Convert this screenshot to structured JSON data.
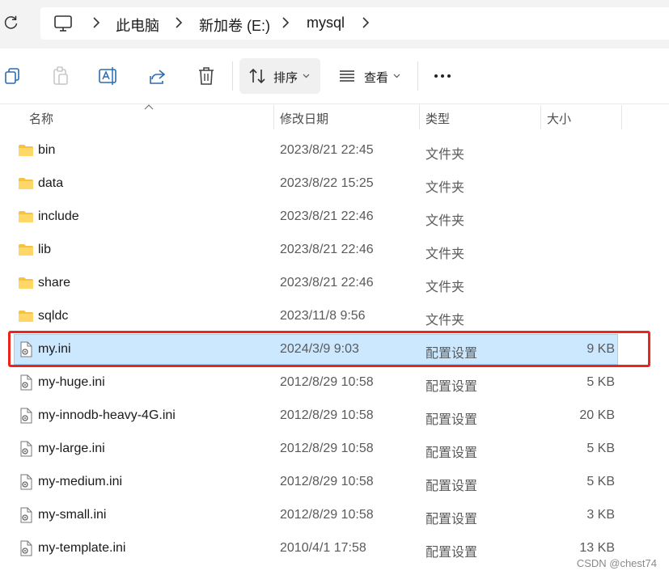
{
  "address_bar": {
    "breadcrumbs": [
      "此电脑",
      "新加卷 (E:)",
      "mysql"
    ],
    "root_icon": "monitor-icon"
  },
  "toolbar": {
    "icons": [
      "copy-icon",
      "paste-icon",
      "rename-icon",
      "share-icon",
      "delete-icon",
      "more-icon"
    ],
    "sort_label": "排序",
    "view_label": "查看",
    "more_label": "..."
  },
  "columns": {
    "name": "名称",
    "date": "修改日期",
    "type": "类型",
    "size": "大小"
  },
  "files": [
    {
      "name": "bin",
      "date": "2023/8/21 22:45",
      "type": "文件夹",
      "size": "",
      "icon": "folder-icon"
    },
    {
      "name": "data",
      "date": "2023/8/22 15:25",
      "type": "文件夹",
      "size": "",
      "icon": "folder-icon"
    },
    {
      "name": "include",
      "date": "2023/8/21 22:46",
      "type": "文件夹",
      "size": "",
      "icon": "folder-icon"
    },
    {
      "name": "lib",
      "date": "2023/8/21 22:46",
      "type": "文件夹",
      "size": "",
      "icon": "folder-icon"
    },
    {
      "name": "share",
      "date": "2023/8/21 22:46",
      "type": "文件夹",
      "size": "",
      "icon": "folder-icon"
    },
    {
      "name": "sqldc",
      "date": "2023/11/8 9:56",
      "type": "文件夹",
      "size": "",
      "icon": "folder-icon"
    },
    {
      "name": "my.ini",
      "date": "2024/3/9 9:03",
      "type": "配置设置",
      "size": "9 KB",
      "icon": "settings-file-icon",
      "selected": true
    },
    {
      "name": "my-huge.ini",
      "date": "2012/8/29 10:58",
      "type": "配置设置",
      "size": "5 KB",
      "icon": "settings-file-icon"
    },
    {
      "name": "my-innodb-heavy-4G.ini",
      "date": "2012/8/29 10:58",
      "type": "配置设置",
      "size": "20 KB",
      "icon": "settings-file-icon"
    },
    {
      "name": "my-large.ini",
      "date": "2012/8/29 10:58",
      "type": "配置设置",
      "size": "5 KB",
      "icon": "settings-file-icon"
    },
    {
      "name": "my-medium.ini",
      "date": "2012/8/29 10:58",
      "type": "配置设置",
      "size": "5 KB",
      "icon": "settings-file-icon"
    },
    {
      "name": "my-small.ini",
      "date": "2012/8/29 10:58",
      "type": "配置设置",
      "size": "3 KB",
      "icon": "settings-file-icon"
    },
    {
      "name": "my-template.ini",
      "date": "2010/4/1 17:58",
      "type": "配置设置",
      "size": "13 KB",
      "icon": "settings-file-icon"
    }
  ],
  "highlight_color": "#e8261c",
  "selection_color": "#cce8ff",
  "watermark": "CSDN @chest74"
}
